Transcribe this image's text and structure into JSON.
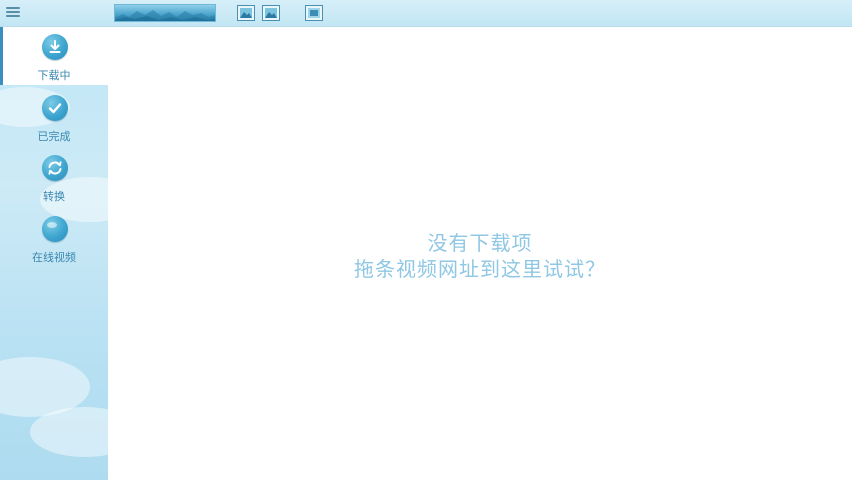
{
  "toolbar": {
    "menu_icon": "hamburger-menu-icon",
    "icons": [
      "image-icon",
      "image-icon",
      "image-icon"
    ]
  },
  "sidebar": {
    "items": [
      {
        "label": "下载中",
        "icon": "download-icon",
        "active": true
      },
      {
        "label": "已完成",
        "icon": "check-icon",
        "active": false
      },
      {
        "label": "转换",
        "icon": "convert-icon",
        "active": false
      },
      {
        "label": "在线视频",
        "icon": "globe-icon",
        "active": false
      }
    ]
  },
  "main": {
    "empty_title": "没有下载项",
    "empty_hint": "拖条视频网址到这里试试？"
  },
  "colors": {
    "accent": "#3da5cf",
    "sidebar_bg": "#c6e8f6",
    "hint_text": "#8fc7e4"
  }
}
